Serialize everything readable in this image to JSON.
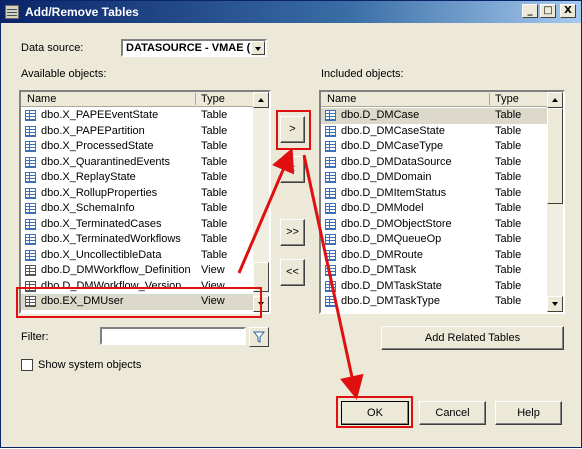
{
  "window": {
    "title": "Add/Remove Tables",
    "minimize": "_",
    "maximize": "□",
    "close": "X"
  },
  "datasource": {
    "label": "Data source:",
    "value": "DATASOURCE - VMAE (pr"
  },
  "available": {
    "label": "Available objects:",
    "columns": {
      "name": "Name",
      "type": "Type"
    },
    "rows": [
      {
        "name": "dbo.X_PAPEEventState",
        "type": "Table",
        "kind": "table"
      },
      {
        "name": "dbo.X_PAPEPartition",
        "type": "Table",
        "kind": "table"
      },
      {
        "name": "dbo.X_ProcessedState",
        "type": "Table",
        "kind": "table"
      },
      {
        "name": "dbo.X_QuarantinedEvents",
        "type": "Table",
        "kind": "table"
      },
      {
        "name": "dbo.X_ReplayState",
        "type": "Table",
        "kind": "table"
      },
      {
        "name": "dbo.X_RollupProperties",
        "type": "Table",
        "kind": "table"
      },
      {
        "name": "dbo.X_SchemaInfo",
        "type": "Table",
        "kind": "table"
      },
      {
        "name": "dbo.X_TerminatedCases",
        "type": "Table",
        "kind": "table"
      },
      {
        "name": "dbo.X_TerminatedWorkflows",
        "type": "Table",
        "kind": "table"
      },
      {
        "name": "dbo.X_UncollectibleData",
        "type": "Table",
        "kind": "table"
      },
      {
        "name": "dbo.D_DMWorkflow_Definition",
        "type": "View",
        "kind": "view"
      },
      {
        "name": "dbo.D_DMWorkflow_Version",
        "type": "View",
        "kind": "view"
      },
      {
        "name": "dbo.EX_DMUser",
        "type": "View",
        "kind": "view",
        "selected": true
      }
    ]
  },
  "included": {
    "label": "Included objects:",
    "columns": {
      "name": "Name",
      "type": "Type"
    },
    "rows": [
      {
        "name": "dbo.D_DMCase",
        "type": "Table",
        "kind": "table",
        "selected": true
      },
      {
        "name": "dbo.D_DMCaseState",
        "type": "Table",
        "kind": "table"
      },
      {
        "name": "dbo.D_DMCaseType",
        "type": "Table",
        "kind": "table"
      },
      {
        "name": "dbo.D_DMDataSource",
        "type": "Table",
        "kind": "table"
      },
      {
        "name": "dbo.D_DMDomain",
        "type": "Table",
        "kind": "table"
      },
      {
        "name": "dbo.D_DMItemStatus",
        "type": "Table",
        "kind": "table"
      },
      {
        "name": "dbo.D_DMModel",
        "type": "Table",
        "kind": "table"
      },
      {
        "name": "dbo.D_DMObjectStore",
        "type": "Table",
        "kind": "table"
      },
      {
        "name": "dbo.D_DMQueueOp",
        "type": "Table",
        "kind": "table"
      },
      {
        "name": "dbo.D_DMRoute",
        "type": "Table",
        "kind": "table"
      },
      {
        "name": "dbo.D_DMTask",
        "type": "Table",
        "kind": "table"
      },
      {
        "name": "dbo.D_DMTaskState",
        "type": "Table",
        "kind": "table"
      },
      {
        "name": "dbo.D_DMTaskType",
        "type": "Table",
        "kind": "table"
      }
    ]
  },
  "buttons": {
    "add": ">",
    "remove": "<",
    "add_all": ">>",
    "remove_all": "<<",
    "add_related": "Add Related Tables",
    "ok": "OK",
    "cancel": "Cancel",
    "help": "Help"
  },
  "filter": {
    "label": "Filter:",
    "value": ""
  },
  "show_system": {
    "label": "Show system objects",
    "checked": false
  },
  "colors": {
    "highlight": "#e01010",
    "title_start": "#0a246a",
    "title_end": "#a6caf0"
  }
}
